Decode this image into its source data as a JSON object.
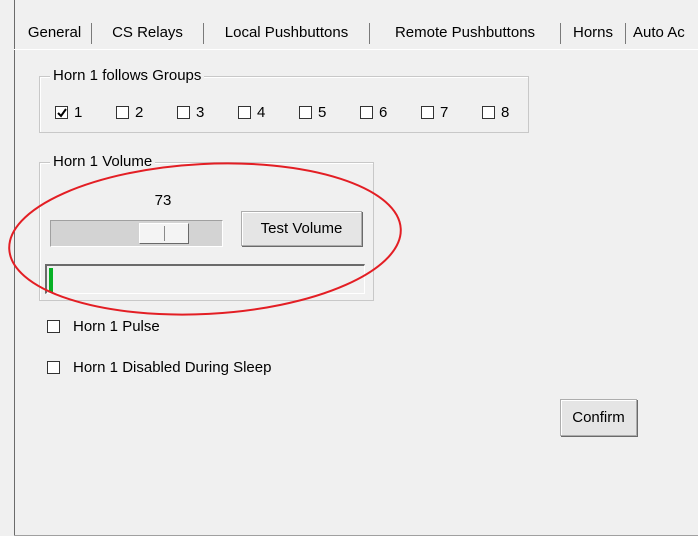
{
  "tabs": [
    {
      "label": "General",
      "active": false
    },
    {
      "label": "CS Relays",
      "active": false
    },
    {
      "label": "Local Pushbuttons",
      "active": false
    },
    {
      "label": "Remote Pushbuttons",
      "active": false
    },
    {
      "label": "Horns",
      "active": true
    },
    {
      "label": "Auto Ac",
      "active": false
    }
  ],
  "groups_box": {
    "title": "Horn 1 follows Groups",
    "items": [
      {
        "label": "1",
        "checked": true
      },
      {
        "label": "2",
        "checked": false
      },
      {
        "label": "3",
        "checked": false
      },
      {
        "label": "4",
        "checked": false
      },
      {
        "label": "5",
        "checked": false
      },
      {
        "label": "6",
        "checked": false
      },
      {
        "label": "7",
        "checked": false
      },
      {
        "label": "8",
        "checked": false
      }
    ]
  },
  "volume_box": {
    "title": "Horn 1 Volume",
    "value_text": "73",
    "slider_value": 73,
    "slider_min": 0,
    "slider_max": 100,
    "test_button_label": "Test Volume",
    "level_fraction": 0.012
  },
  "options": {
    "pulse_label": "Horn 1 Pulse",
    "pulse_checked": false,
    "sleep_label": "Horn 1 Disabled During Sleep",
    "sleep_checked": false
  },
  "confirm_label": "Confirm",
  "colors": {
    "annotation": "#e31e24",
    "level_fill": "#06b025",
    "check": "#000000"
  }
}
